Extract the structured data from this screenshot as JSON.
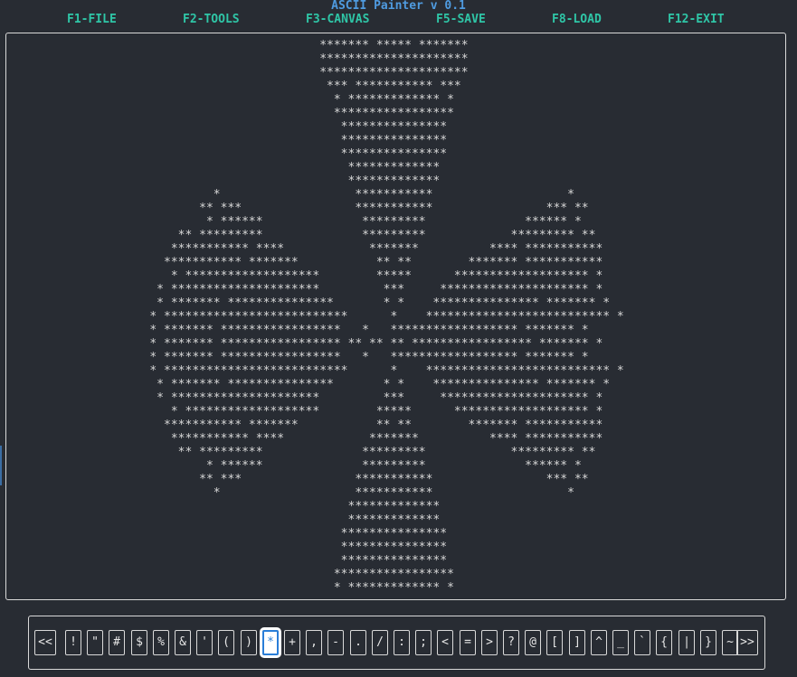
{
  "app": {
    "title": "ASCII Painter v 0.1"
  },
  "menu": {
    "items": [
      {
        "label": "F1-FILE"
      },
      {
        "label": "F2-TOOLS"
      },
      {
        "label": "F3-CANVAS"
      },
      {
        "label": "F5-SAVE"
      },
      {
        "label": "F8-LOAD"
      },
      {
        "label": "F12-EXIT"
      }
    ]
  },
  "canvas": {
    "lines": [
      "                                             ******* ***** *******",
      "                                             *********************",
      "                                             *********************",
      "                                              *** *********** ***",
      "                                               * ************* *",
      "                                               *****************",
      "                                                ***************",
      "                                                ***************",
      "                                                ***************",
      "                                                 *************",
      "                                                 *************",
      "                              *                   ***********                   *",
      "                            ** ***                ***********                *** **",
      "                             * ******              *********              ****** *",
      "                         ** *********              *********            ********* **",
      "                        *********** ****            *******          **** ***********",
      "                       *********** *******           ** **        ******* ***********",
      "                        * *******************        *****      ******************* *",
      "                      * *********************         ***     ********************* *",
      "                      * ******* ***************       * *    *************** ******* *",
      "                     * **************************      *    ************************** *",
      "                     * ******* *****************   *   ****************** ******* *",
      "                     * ******* ***************** ** ** ** ***************** ******* *",
      "                     * ******* *****************   *   ****************** ******* *",
      "                     * **************************      *    ************************** *",
      "                      * ******* ***************       * *    *************** ******* *",
      "                      * *********************         ***     ********************* *",
      "                        * *******************        *****      ******************* *",
      "                       *********** *******           ** **        ******* ***********",
      "                        *********** ****            *******          **** ***********",
      "                         ** *********              *********            ********* **",
      "                             * ******              *********              ****** *",
      "                            ** ***                ***********                *** **",
      "                              *                   ***********                   *",
      "                                                 *************",
      "                                                 *************",
      "                                                ***************",
      "                                                ***************",
      "                                                ***************",
      "                                               *****************",
      "                                               * ************* *"
    ]
  },
  "palette": {
    "prev_label": "<<",
    "next_label": ">>",
    "selected": "*",
    "chars": [
      "!",
      "\"",
      "#",
      "$",
      "%",
      "&",
      "'",
      "(",
      ")",
      "*",
      "+",
      ",",
      "-",
      ".",
      "/",
      ":",
      ";",
      "<",
      "=",
      ">",
      "?",
      "@",
      "[",
      "]",
      "^",
      "_",
      "`",
      "{",
      "|",
      "}",
      "~"
    ]
  }
}
